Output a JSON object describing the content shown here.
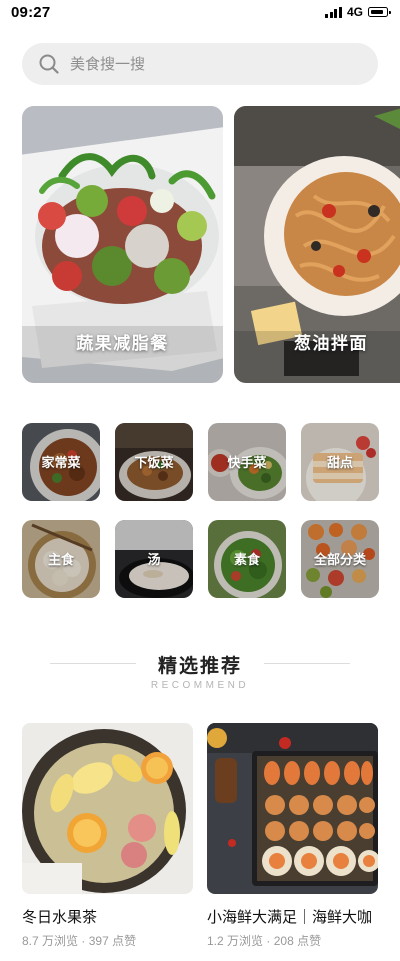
{
  "status_bar": {
    "time": "09:27",
    "network": "4G"
  },
  "search": {
    "placeholder": "美食搜一搜"
  },
  "banners": [
    {
      "label": "蔬果减脂餐"
    },
    {
      "label": "葱油拌面"
    }
  ],
  "categories": [
    {
      "label": "家常菜"
    },
    {
      "label": "下饭菜"
    },
    {
      "label": "快手菜"
    },
    {
      "label": "甜点"
    },
    {
      "label": "主食"
    },
    {
      "label": "汤"
    },
    {
      "label": "素食"
    },
    {
      "label": "全部分类"
    }
  ],
  "recommend": {
    "title": "精选推荐",
    "subtitle": "RECOMMEND",
    "items": [
      {
        "title": "冬日水果茶",
        "views": "8.7 万浏览",
        "likes": "397 点赞"
      },
      {
        "title": "小海鲜大满足｜海鲜大咖",
        "views": "1.2 万浏览",
        "likes": "208 点赞"
      }
    ]
  },
  "colors": {
    "text_primary": "#222222",
    "text_muted": "#999999",
    "search_bg": "#eeeeee"
  }
}
